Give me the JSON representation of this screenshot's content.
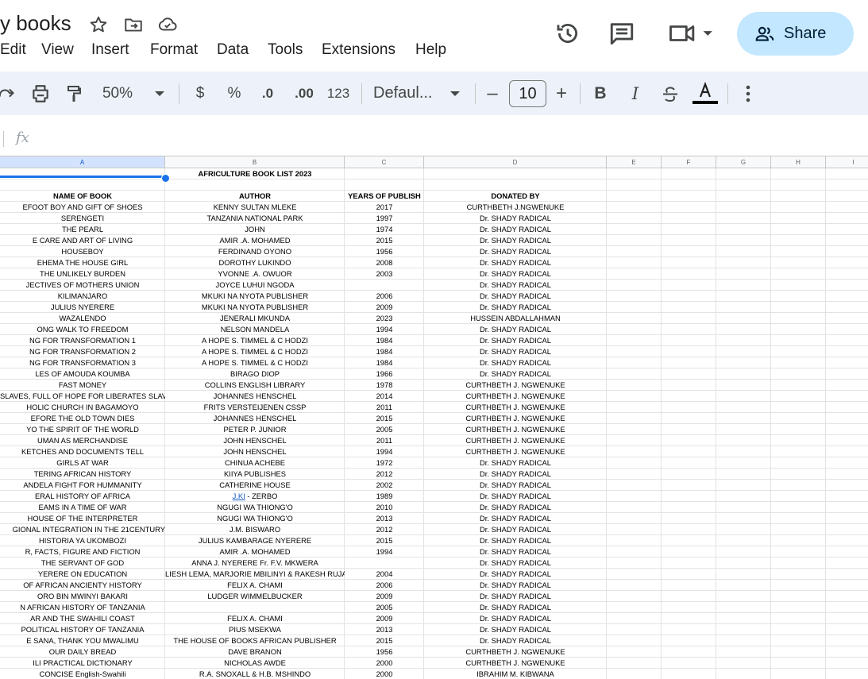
{
  "doc": {
    "title": "y books"
  },
  "menu": [
    "Edit",
    "View",
    "Insert",
    "Format",
    "Data",
    "Tools",
    "Extensions",
    "Help"
  ],
  "share": {
    "label": "Share"
  },
  "toolbar": {
    "zoom": "50%",
    "currency": "$",
    "percent": "%",
    "decrease_decimal": ".0",
    "increase_decimal": ".00",
    "number_format": "123",
    "font": "Defaul...",
    "font_size": "10",
    "minus": "–",
    "plus": "+",
    "bold": "B",
    "italic": "I"
  },
  "formula": {
    "fx": "fx"
  },
  "columns": [
    "A",
    "B",
    "C",
    "D",
    "E",
    "F",
    "G",
    "H",
    "I"
  ],
  "sheet": {
    "title_row": "AFRICULTURE BOOK LIST 2023",
    "headers": [
      "NAME OF BOOK",
      "AUTHOR",
      "YEARS OF PUBLISH",
      "DONATED BY"
    ],
    "rows": [
      [
        "EFOOT BOY AND GIFT OF SHOES",
        "KENNY SULTAN MLEKE",
        "2017",
        "CURTHBETH J.NGWENUKE"
      ],
      [
        "SERENGETI",
        "TANZANIA NATIONAL PARK",
        "1997",
        "Dr. SHADY RADICAL"
      ],
      [
        "THE PEARL",
        "JOHN",
        "1974",
        "Dr. SHADY RADICAL"
      ],
      [
        "E CARE AND ART OF LIVING",
        "AMIR .A. MOHAMED",
        "2015",
        "Dr. SHADY RADICAL"
      ],
      [
        "HOUSEBOY",
        "FERDINAND OYONO",
        "1956",
        "Dr. SHADY RADICAL"
      ],
      [
        "EHEMA THE HOUSE GIRL",
        "DOROTHY LUKINDO",
        "2008",
        "Dr. SHADY RADICAL"
      ],
      [
        "THE UNLIKELY BURDEN",
        "YVONNE .A. OWUOR",
        "2003",
        "Dr. SHADY RADICAL"
      ],
      [
        "JECTIVES OF MOTHERS UNION",
        "JOYCE LUHUI NGODA",
        "",
        "Dr. SHADY RADICAL"
      ],
      [
        "KILIMANJARO",
        "MKUKI NA NYOTA PUBLISHER",
        "2006",
        "Dr. SHADY RADICAL"
      ],
      [
        "JULIUS NYERERE",
        "MKUKI NA NYOTA PUBLISHER",
        "2009",
        "Dr. SHADY RADICAL"
      ],
      [
        "WAZALENDO",
        "JENERALI MKUNDA",
        "2023",
        "HUSSEIN ABDALLAHMAN"
      ],
      [
        "ONG WALK TO FREEDOM",
        "NELSON MANDELA",
        "1994",
        "Dr. SHADY RADICAL"
      ],
      [
        "NG FOR TRANSFORMATION 1",
        "A HOPE S. TIMMEL & C HODZI",
        "1984",
        "Dr. SHADY RADICAL"
      ],
      [
        "NG FOR TRANSFORMATION 2",
        "A HOPE S. TIMMEL & C HODZI",
        "1984",
        "Dr. SHADY RADICAL"
      ],
      [
        "NG FOR TRANSFORMATION 3",
        "A HOPE S. TIMMEL & C HODZI",
        "1984",
        "Dr. SHADY RADICAL"
      ],
      [
        "LES OF AMOUDA KOUMBA",
        "BIRAGO DIOP",
        "1966",
        "Dr. SHADY RADICAL"
      ],
      [
        "FAST MONEY",
        "COLLINS ENGLISH LIBRARY",
        "1978",
        "CURTHBETH J. NGWENUKE"
      ],
      [
        "SLAVES,  FULL OF HOPE FOR LIBERATES SLAV",
        "JOHANNES HENSCHEL",
        "2014",
        "CURTHBETH J. NGWENUKE"
      ],
      [
        "HOLIC CHURCH IN BAGAMOYO",
        "FRITS VERSTEIJENEN CSSP",
        "2011",
        "CURTHBETH J. NGWENUKE"
      ],
      [
        "EFORE THE OLD TOWN DIES",
        "JOHANNES HENSCHEL",
        "2015",
        "CURTHBETH J. NGWENUKE"
      ],
      [
        "YO THE SPIRIT OF THE WORLD",
        "PETER P. JUNIOR",
        "2005",
        "CURTHBETH J. NGWENUKE"
      ],
      [
        "UMAN AS MERCHANDISE",
        "JOHN HENSCHEL",
        "2011",
        "CURTHBETH J. NGWENUKE"
      ],
      [
        "KETCHES AND DOCUMENTS TELL",
        "JOHN HENSCHEL",
        "1994",
        "CURTHBETH J. NGWENUKE"
      ],
      [
        "GIRLS AT WAR",
        "CHINUA ACHEBE",
        "1972",
        "Dr. SHADY RADICAL"
      ],
      [
        "TERING AFRICAN HISTORY",
        "KIIYA PUBLISHES",
        "2012",
        "Dr. SHADY RADICAL"
      ],
      [
        "ANDELA FIGHT FOR HUMMANITY",
        "CATHERINE HOUSE",
        "2002",
        "Dr. SHADY RADICAL"
      ],
      [
        "ERAL HISTORY OF AFRICA",
        "J.KI - ZERBO",
        "1989",
        "Dr. SHADY RADICAL"
      ],
      [
        "EAMS IN A TIME OF WAR",
        "NGUGI WA THIONG'O",
        "2010",
        "Dr. SHADY RADICAL"
      ],
      [
        "HOUSE OF THE INTERPRETER",
        "NGUGI WA THIONG'O",
        "2013",
        "Dr. SHADY RADICAL"
      ],
      [
        "GIONAL INTEGRATION IN THE 21CENTURY",
        "J.M. BISWARO",
        "2012",
        "Dr. SHADY RADICAL"
      ],
      [
        "HISTORIA YA UKOMBOZI",
        "JULIUS KAMBARAGE NYERERE",
        "2015",
        "Dr. SHADY RADICAL"
      ],
      [
        "R, FACTS, FIGURE AND FICTION",
        "AMIR .A. MOHAMED",
        "1994",
        "Dr. SHADY RADICAL"
      ],
      [
        "THE SERVANT OF GOD",
        "ANNA J. NYERERE Fr. F.V. MKWERA",
        "",
        "Dr. SHADY RADICAL"
      ],
      [
        "YERERE ON EDUCATION",
        "LIESH LEMA, MARJORIE MBILINYI & RAKESH RUJAN",
        "2004",
        "Dr. SHADY RADICAL"
      ],
      [
        "OF AFRICAN ANCIENTY HISTORY",
        "FELIX A. CHAMI",
        "2006",
        "Dr. SHADY RADICAL"
      ],
      [
        "ORO BIN MWINYI BAKARI",
        "LUDGER WIMMELBUCKER",
        "2009",
        "Dr. SHADY RADICAL"
      ],
      [
        "N AFRICAN HISTORY OF TANZANIA",
        "",
        "2005",
        "Dr. SHADY RADICAL"
      ],
      [
        "AR AND  THE SWAHILI COAST",
        "FELIX A. CHAMI",
        "2009",
        "Dr. SHADY RADICAL"
      ],
      [
        "POLITICAL HISTORY OF TANZANIA",
        "PIUS MSEKWA",
        "2013",
        "Dr. SHADY RADICAL"
      ],
      [
        "E SANA, THANK YOU MWALIMU",
        "THE HOUSE OF BOOKS AFRICAN PUBLISHER",
        "2015",
        "Dr. SHADY RADICAL"
      ],
      [
        "OUR DAILY BREAD",
        "DAVE BRANON",
        "1956",
        "CURTHBETH J. NGWENUKE"
      ],
      [
        "ILI PRACTICAL DICTIONARY",
        "NICHOLAS AWDE",
        "2000",
        "CURTHBETH J. NGWENUKE"
      ],
      [
        "CONCISE English-Swahili",
        "R.A. SNOXALL & H.B. MSHINDO",
        "2000",
        "IBRAHIM M. KIBWANA"
      ]
    ]
  },
  "colors": {
    "share_bg": "#c2e7ff",
    "toolbar_bg": "#edf2fa",
    "selection": "#1a73e8",
    "link": "#1155cc"
  },
  "icons": [
    "star-icon",
    "move-to-folder-icon",
    "cloud-saved-icon",
    "history-icon",
    "comment-icon",
    "video-call-icon",
    "share-people-icon",
    "redo-icon",
    "print-icon",
    "paint-format-icon",
    "dropdown-icon",
    "strikethrough-icon",
    "text-color-icon",
    "more-vert-icon"
  ]
}
